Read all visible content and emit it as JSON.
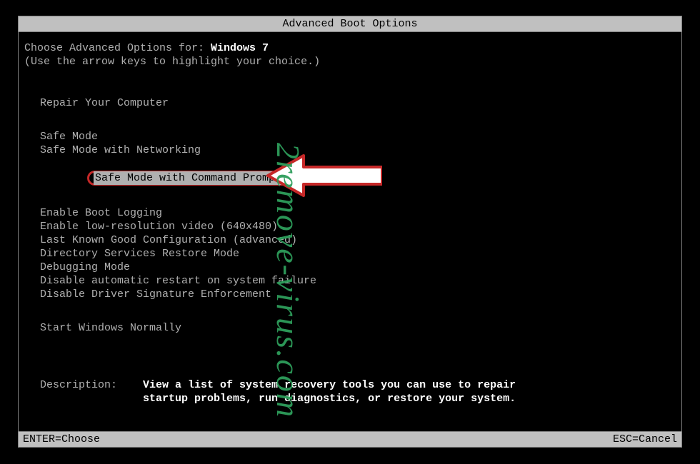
{
  "title": "Advanced Boot Options",
  "choose_prefix": "Choose Advanced Options for: ",
  "os_name": "Windows 7",
  "hint": "(Use the arrow keys to highlight your choice.)",
  "menu": {
    "group1": [
      "Repair Your Computer"
    ],
    "group2": [
      "Safe Mode",
      "Safe Mode with Networking"
    ],
    "selected": "Safe Mode with Command Prompt",
    "group3": [
      "Enable Boot Logging",
      "Enable low-resolution video (640x480)",
      "Last Known Good Configuration (advanced)",
      "Directory Services Restore Mode",
      "Debugging Mode",
      "Disable automatic restart on system failure",
      "Disable Driver Signature Enforcement"
    ],
    "group4": [
      "Start Windows Normally"
    ]
  },
  "description": {
    "label": "Description:    ",
    "line1": "View a list of system recovery tools you can use to repair",
    "line2": "startup problems, run diagnostics, or restore your system."
  },
  "footer": {
    "left": "ENTER=Choose",
    "right": "ESC=Cancel"
  },
  "watermark": "2remove-virus.com",
  "colors": {
    "highlight_border": "#c62828",
    "watermark": "#2e9e5b"
  }
}
